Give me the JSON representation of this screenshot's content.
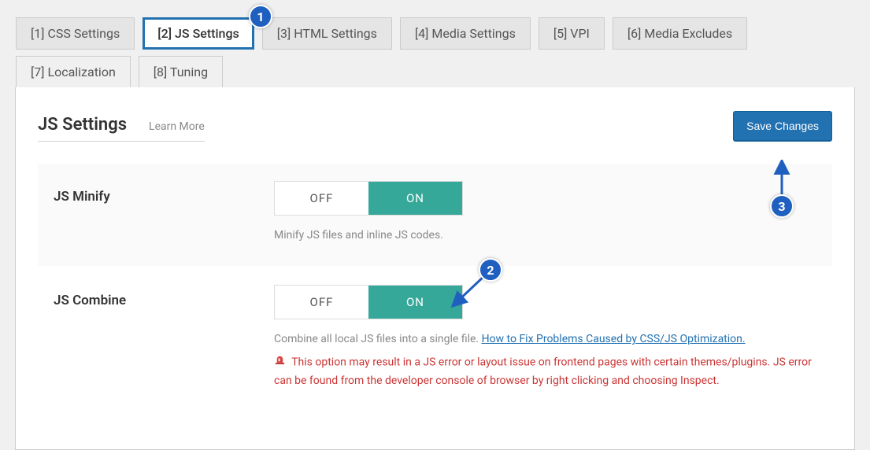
{
  "tabs_row1": [
    {
      "label": "[1] CSS Settings",
      "active": false
    },
    {
      "label": "[2] JS Settings",
      "active": true
    },
    {
      "label": "[3] HTML Settings",
      "active": false
    },
    {
      "label": "[4] Media Settings",
      "active": false
    },
    {
      "label": "[5] VPI",
      "active": false
    },
    {
      "label": "[6] Media Excludes",
      "active": false
    }
  ],
  "tabs_row2": [
    {
      "label": "[7] Localization"
    },
    {
      "label": "[8] Tuning"
    }
  ],
  "panel": {
    "title": "JS Settings",
    "learn_more": "Learn More",
    "save_button": "Save Changes"
  },
  "toggle_labels": {
    "off": "OFF",
    "on": "ON"
  },
  "settings": {
    "js_minify": {
      "label": "JS Minify",
      "value": "ON",
      "desc": "Minify JS files and inline JS codes."
    },
    "js_combine": {
      "label": "JS Combine",
      "value": "ON",
      "desc_prefix": "Combine all local JS files into a single file. ",
      "desc_link": "How to Fix Problems Caused by CSS/JS Optimization.",
      "warn": "This option may result in a JS error or layout issue on frontend pages with certain themes/plugins. JS error can be found from the developer console of browser by right clicking and choosing Inspect."
    }
  },
  "annotations": {
    "b1": "1",
    "b2": "2",
    "b3": "3"
  }
}
